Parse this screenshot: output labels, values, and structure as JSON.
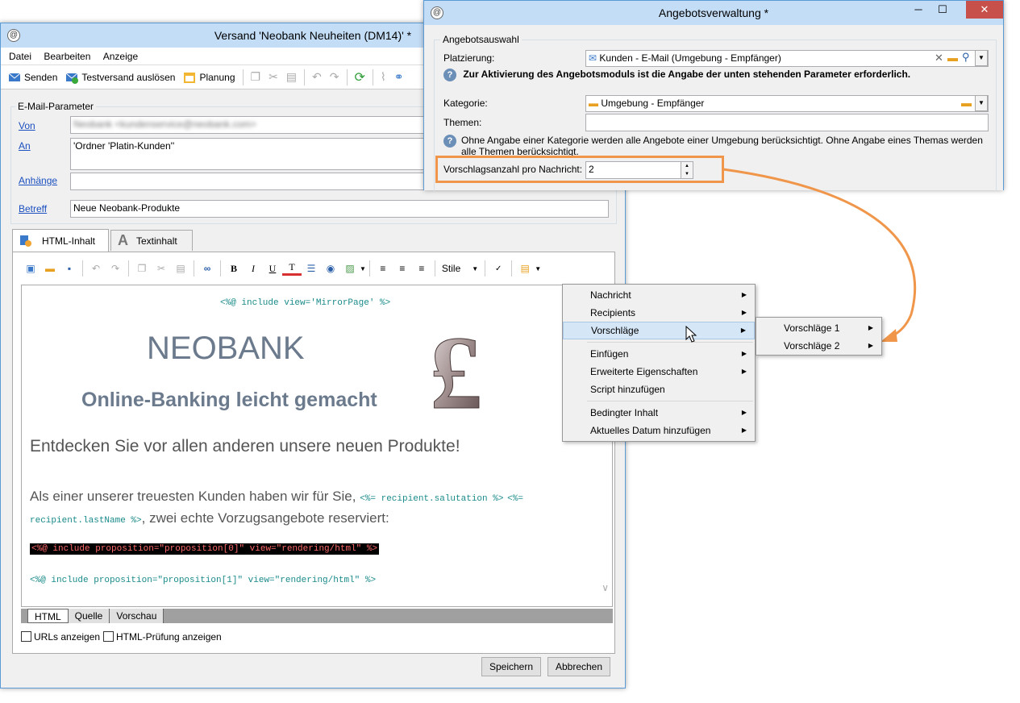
{
  "main_window": {
    "title": "Versand 'Neobank Neuheiten (DM14)' *",
    "menu": [
      "Datei",
      "Bearbeiten",
      "Anzeige"
    ],
    "toolbar": {
      "send": "Senden",
      "test_send": "Testversand auslösen",
      "planning": "Planung"
    },
    "email_params": {
      "group_label": "E-Mail-Parameter",
      "from_label": "Von",
      "from_value": "Neobank <kundenservice@neobank.com>",
      "to_label": "An",
      "to_value": "'Ordner 'Platin-Kunden''",
      "attachments_label": "Anhänge",
      "attachments_value": "",
      "subject_label": "Betreff",
      "subject_value": "Neue Neobank-Produkte"
    },
    "tabs": {
      "html": "HTML-Inhalt",
      "text": "Textinhalt"
    },
    "editor_toolbar": {
      "bold": "B",
      "italic": "I",
      "underline": "U",
      "style": "Stile"
    },
    "content": {
      "include_mirror": "<%@ include view='MirrorPage' %>",
      "brand": "NEOBANK",
      "tagline": "Online-Banking leicht gemacht",
      "headline": "Entdecken Sie vor allen anderen unsere neuen Produkte!",
      "body_text_1": "Als einer unserer treuesten Kunden haben wir für Sie,",
      "code_salutation": "<%= recipient.salutation %>",
      "code_lastname_1": "<%=",
      "code_lastname_2": "recipient.lastName %>",
      "body_text_2": ", zwei echte Vorzugsangebote reserviert:",
      "include_prop0": "<%@ include proposition=\"proposition[0]\" view=\"rendering/html\" %>",
      "include_prop1": "<%@ include proposition=\"proposition[1]\" view=\"rendering/html\" %>"
    },
    "bottom_tabs": [
      "HTML",
      "Quelle",
      "Vorschau"
    ],
    "show_urls": "URLs anzeigen",
    "html_check": "HTML-Prüfung anzeigen",
    "save": "Speichern",
    "cancel": "Abbrechen"
  },
  "offer_window": {
    "title": "Angebotsverwaltung *",
    "group_label": "Angebotsauswahl",
    "placement_label": "Platzierung:",
    "placement_value": "Kunden - E-Mail (Umgebung - Empfänger)",
    "info_bold": "Zur Aktivierung des Angebotsmoduls ist die Angabe der unten stehenden Parameter erforderlich.",
    "category_label": "Kategorie:",
    "category_value": "Umgebung - Empfänger",
    "themes_label": "Themen:",
    "themes_value": "",
    "info_text": "Ohne Angabe einer Kategorie werden alle Angebote einer Umgebung berücksichtigt. Ohne Angabe eines Themas werden alle Themen berücksichtigt.",
    "count_label": "Vorschlagsanzahl pro Nachricht:",
    "count_value": "2"
  },
  "context_menu": {
    "items": [
      "Nachricht",
      "Recipients",
      "Vorschläge",
      "Einfügen",
      "Erweiterte Eigenschaften",
      "Script hinzufügen",
      "Bedingter Inhalt",
      "Aktuelles Datum hinzufügen"
    ],
    "submenu": [
      "Vorschläge 1",
      "Vorschläge 2"
    ]
  },
  "colors": {
    "accent_orange": "#f0964a",
    "title_bar": "#c3ddf6",
    "window_border": "#5b9bd5",
    "text_gray": "#6b7a8c"
  }
}
